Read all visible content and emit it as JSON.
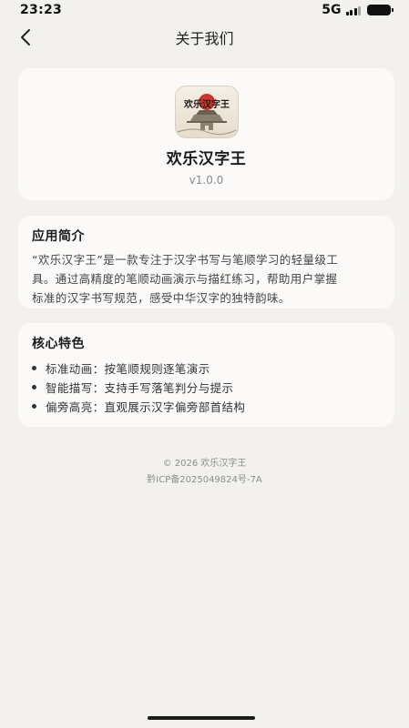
{
  "status_bar": {
    "time": "23:23",
    "network": "5G",
    "icons": [
      "signal-icon",
      "battery-icon"
    ]
  },
  "nav": {
    "title": "关于我们",
    "back_icon": "chevron-left-icon"
  },
  "app": {
    "name": "欢乐汉字王",
    "version": "v1.0.0",
    "logo_text": "欢乐汉字王"
  },
  "intro": {
    "title": "应用简介",
    "lines": [
      "“欢乐汉字王”是一款专注于汉字书写与笔顺学习的轻量级工",
      "具。通过高精度的笔顺动画演示与描红练习，帮助用户掌握",
      "标准的汉字书写规范，感受中华汉字的独特韵味。"
    ]
  },
  "features": {
    "title": "核心特色",
    "items": [
      "标准动画：按笔顺规则逐笔演示",
      "智能描写：支持手写落笔判分与提示",
      "偏旁高亮：直观展示汉字偏旁部首结构"
    ]
  },
  "footer": {
    "copyright": "© 2026 欢乐汉字王",
    "icp": "黔ICP备2025049824号-7A"
  },
  "colors": {
    "background": "#f3f1ee",
    "card": "#fbfaf8",
    "logo_sun": "#c8372d"
  }
}
